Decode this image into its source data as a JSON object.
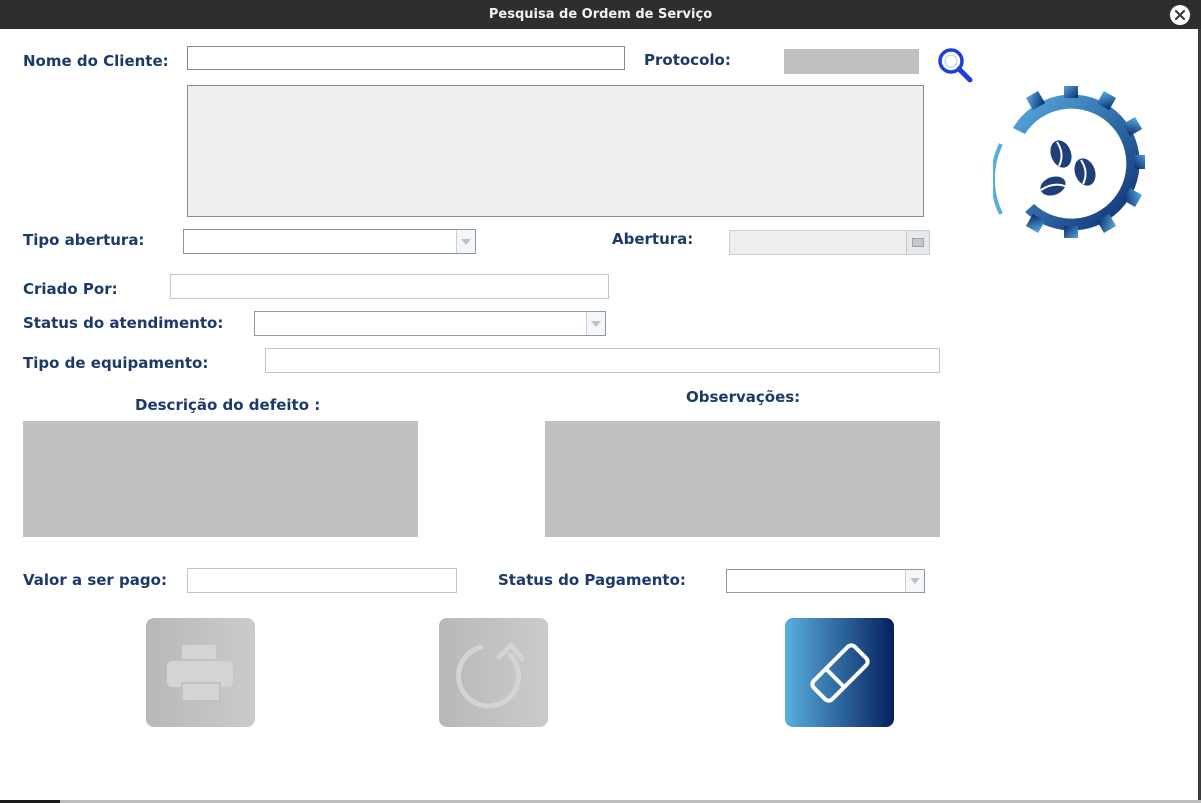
{
  "window": {
    "title": "Pesquisa de Ordem de Serviço"
  },
  "form": {
    "nome_cliente_label": "Nome do Cliente:",
    "protocolo_label": "Protocolo:",
    "tipo_abertura_label": "Tipo abertura:",
    "abertura_label": "Abertura:",
    "criado_por_label": "Criado Por:",
    "status_atendimento_label": "Status do atendimento:",
    "tipo_equipamento_label": "Tipo de equipamento:",
    "descricao_defeito_label": "Descrição do defeito :",
    "observacoes_label": "Observações:",
    "valor_label": "Valor a ser pago:",
    "status_pagamento_label": "Status do Pagamento:"
  },
  "values": {
    "nome_cliente": "",
    "protocolo": "",
    "tipo_abertura": "",
    "abertura": "",
    "criado_por": "",
    "status_atendimento": "",
    "tipo_equipamento": "",
    "valor": "",
    "status_pagamento": ""
  },
  "icons": {
    "search": "search-icon",
    "calendar": "calendar-icon",
    "logo": "coffee-gear-logo",
    "print": "printer-icon",
    "refresh": "refresh-icon",
    "clear": "eraser-icon"
  },
  "colors": {
    "label": "#1b3a6b",
    "accent_light": "#58aee0",
    "accent_dark": "#06205e",
    "disabled": "#c0c0c0",
    "search_icon": "#1f3fd6"
  }
}
